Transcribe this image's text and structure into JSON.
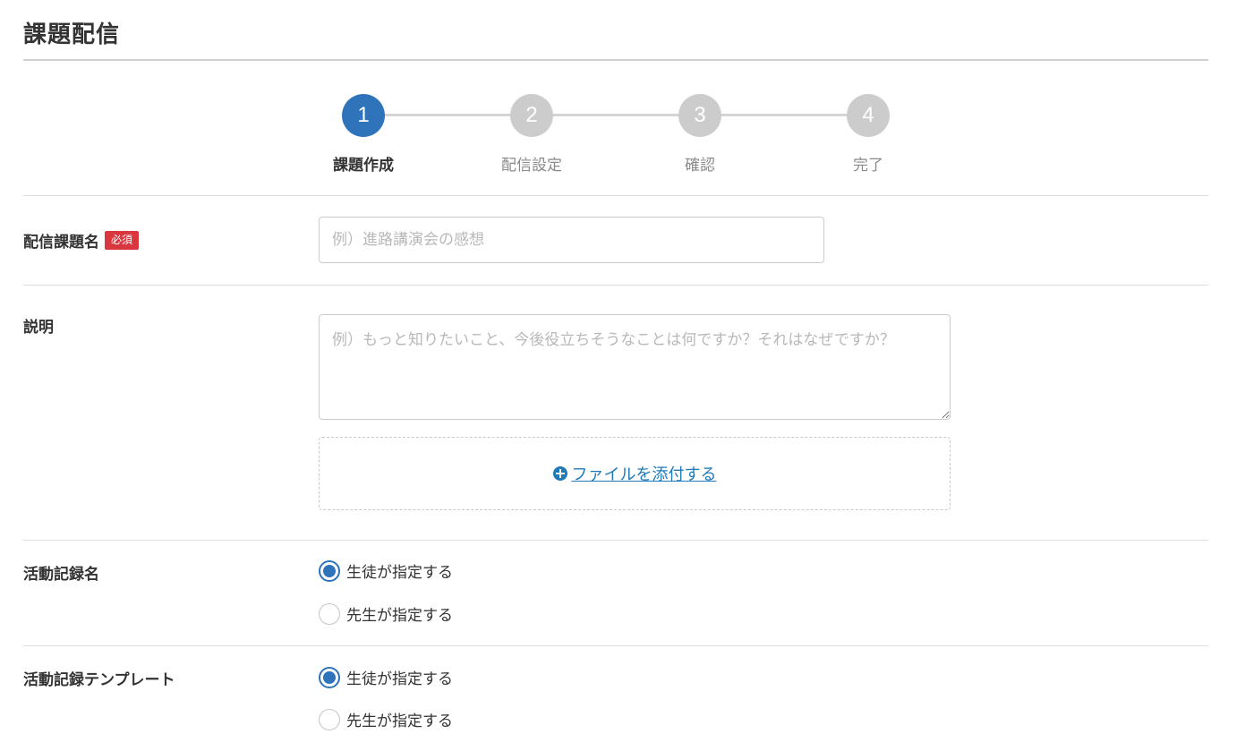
{
  "page": {
    "title": "課題配信"
  },
  "stepper": {
    "steps": [
      {
        "number": "1",
        "label": "課題作成",
        "active": true
      },
      {
        "number": "2",
        "label": "配信設定",
        "active": false
      },
      {
        "number": "3",
        "label": "確認",
        "active": false
      },
      {
        "number": "4",
        "label": "完了",
        "active": false
      }
    ]
  },
  "form": {
    "assignment_name": {
      "label": "配信課題名",
      "required_badge": "必須",
      "placeholder": "例）進路講演会の感想",
      "value": ""
    },
    "description": {
      "label": "説明",
      "placeholder": "例）もっと知りたいこと、今後役立ちそうなことは何ですか？それはなぜですか？",
      "value": "",
      "attach_label": "ファイルを添付する"
    },
    "activity_record_name": {
      "label": "活動記録名",
      "options": [
        {
          "label": "生徒が指定する",
          "checked": true
        },
        {
          "label": "先生が指定する",
          "checked": false
        }
      ]
    },
    "activity_record_template": {
      "label": "活動記録テンプレート",
      "options": [
        {
          "label": "生徒が指定する",
          "checked": true
        },
        {
          "label": "先生が指定する",
          "checked": false
        }
      ]
    }
  },
  "colors": {
    "accent": "#2f73bb",
    "step_inactive": "#cccccc",
    "required": "#d9363e",
    "link": "#1f7ab8"
  }
}
